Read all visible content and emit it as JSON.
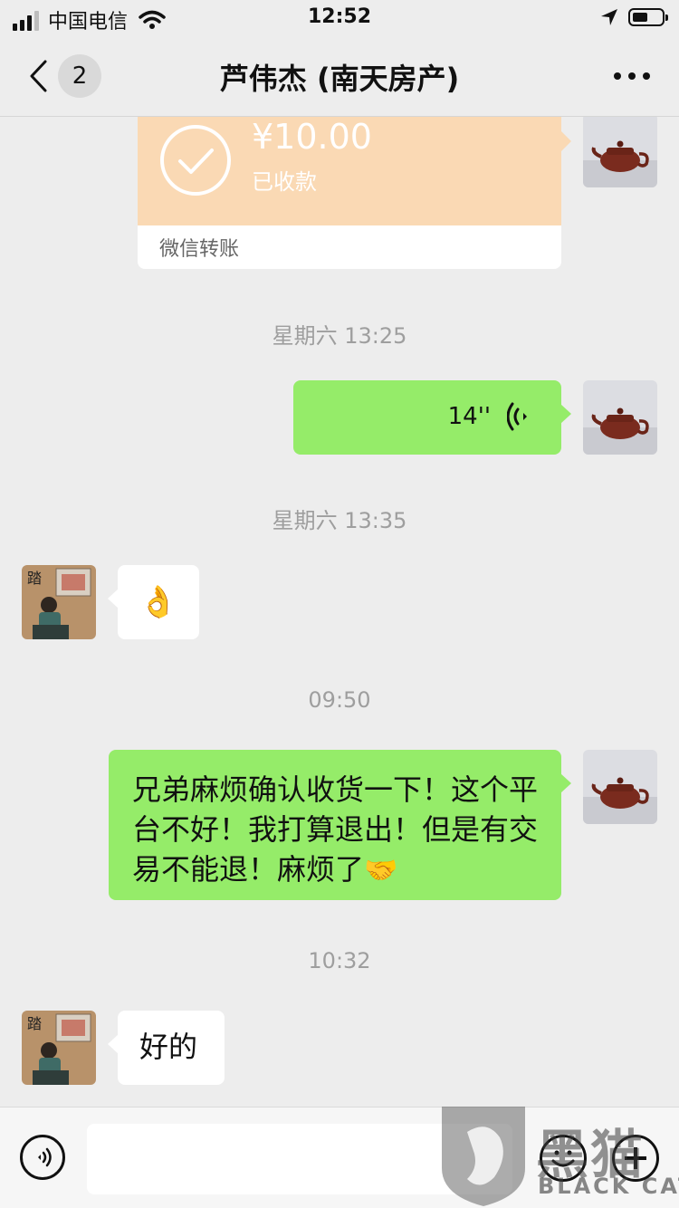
{
  "status_bar": {
    "carrier": "中国电信",
    "time": "12:52"
  },
  "nav": {
    "unread_count": "2",
    "title": "芦伟杰 (南天房产)"
  },
  "messages": {
    "transfer": {
      "amount": "¥10.00",
      "status": "已收款",
      "label": "微信转账"
    },
    "time_1": "星期六 13:25",
    "voice": {
      "duration": "14''"
    },
    "time_2": "星期六 13:35",
    "emoji_reply": "👌",
    "time_3": "09:50",
    "sent_text": "兄弟麻烦确认收货一下！这个平台不好！我打算退出！但是有交易不能退！麻烦了",
    "sent_text_emoji": "🤝",
    "time_4": "10:32",
    "reply_text": "好的"
  },
  "watermark": {
    "cn": "黑猫",
    "en": "BLACK CAT"
  },
  "colors": {
    "bubble_green": "#95EC69",
    "transfer_orange": "#FAD9B4",
    "background": "#EDEDED"
  },
  "icons": [
    "back-chevron-icon",
    "more-icon",
    "check-icon",
    "voice-wave-icon",
    "voice-mode-icon",
    "emoji-icon",
    "plus-icon"
  ]
}
